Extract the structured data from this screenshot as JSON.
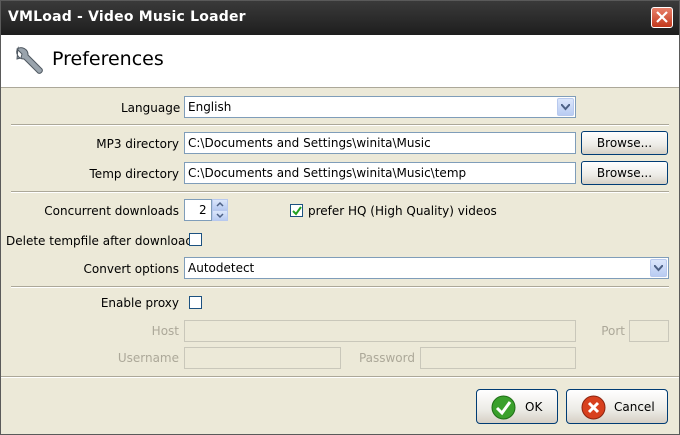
{
  "window": {
    "title": "VMLoad - Video Music Loader"
  },
  "header": {
    "title": "Preferences"
  },
  "language": {
    "label": "Language",
    "value": "English"
  },
  "mp3_directory": {
    "label": "MP3 directory",
    "value": "C:\\Documents and Settings\\winita\\Music",
    "browse_label": "Browse..."
  },
  "temp_directory": {
    "label": "Temp directory",
    "value": "C:\\Documents and Settings\\winita\\Music\\temp",
    "browse_label": "Browse..."
  },
  "concurrent_downloads": {
    "label": "Concurrent downloads",
    "value": "2"
  },
  "prefer_hq": {
    "label": "prefer HQ (High Quality) videos",
    "checked": true
  },
  "delete_tempfile": {
    "label": "Delete tempfile after download",
    "checked": false
  },
  "convert_options": {
    "label": "Convert options",
    "value": "Autodetect"
  },
  "proxy": {
    "enable_label": "Enable proxy",
    "enabled": false,
    "host_label": "Host",
    "port_label": "Port",
    "username_label": "Username",
    "password_label": "Password"
  },
  "buttons": {
    "ok_label": "OK",
    "cancel_label": "Cancel"
  },
  "colors": {
    "title_bar": "#2a2a2a",
    "close_red": "#c2381c",
    "dialog_bg": "#ece9d8",
    "ok_green": "#3aa02c"
  }
}
